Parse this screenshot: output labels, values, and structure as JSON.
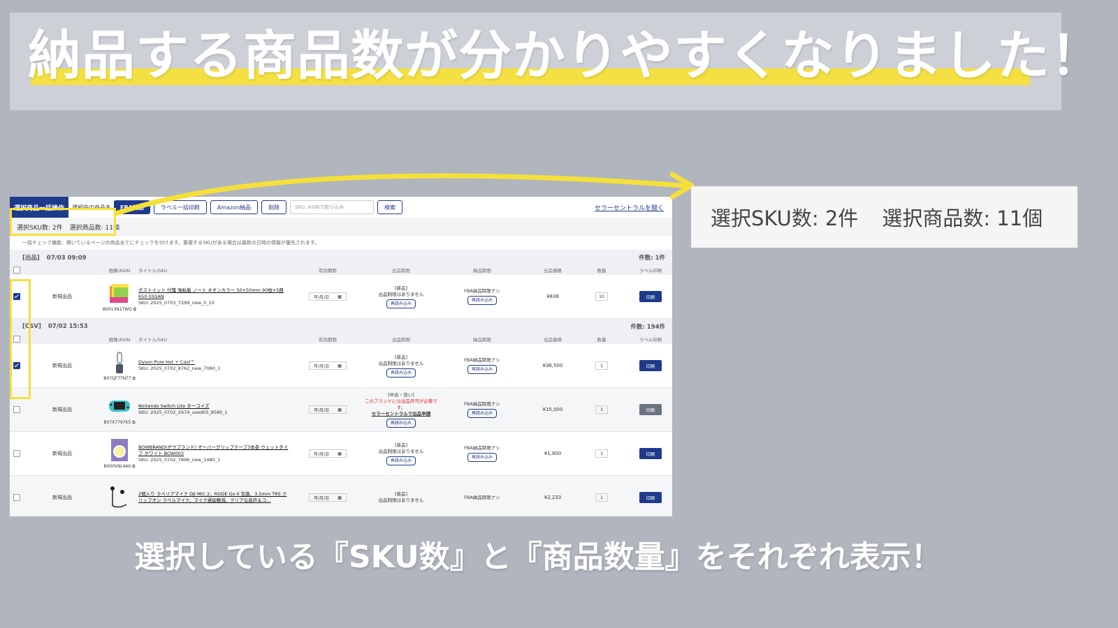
{
  "headline": "納品する商品数が分かりやすくなりました！",
  "caption": "選択している『SKU数』と『商品数量』をそれぞれ表示！",
  "zoom": {
    "sku": "選択SKU数: 2件",
    "items": "選択商品数: 11個"
  },
  "toolbar": {
    "tab": "選択商品一括操作",
    "label": "選択中の商品を",
    "fba": "FBA納品",
    "label_bulk": "ラベル一括印刷",
    "amazon": "Amazon納品",
    "delete": "削除",
    "search_placeholder": "SKU, ASINで絞り込み",
    "search_btn": "検索",
    "seller_link": "セラーセントラルを開く"
  },
  "counts": {
    "sku": "選択SKU数: 2件",
    "items": "選択商品数: 11個"
  },
  "note": "一括チェック機能：開いているページの商品全てにチェックを付けます。重複するSKUがある場合は最新の日時の情報が優先されます。",
  "columns": [
    "",
    "",
    "画像/ASIN",
    "タイトル/SKU",
    "有効期限",
    "出品制限",
    "納品制限",
    "出品価格",
    "数量",
    "ラベル印刷"
  ],
  "groups": [
    {
      "tag": "[出品]",
      "time": "07/03 09:09",
      "count": "件数: 1件",
      "rows": [
        {
          "checked": true,
          "status": "新規出品",
          "asin": "B0013N1TWG",
          "title": "ポストイット 付箋 強粘着 ノート ネオンカラー 50×50mm 90枚×5冊 650-5SSAN",
          "sku": "SKU: 2025_0703_7299_new_0_10",
          "date": "年/月/日",
          "restrict_tag": "[新品]",
          "restrict_text": "出品制限はありません",
          "restrict_alert": "",
          "restrict_link": "",
          "restrict_btn": "再読み込み",
          "fba_text": "FBA納品制限ナシ",
          "fba_btn": "再読み込み",
          "price": "¥838",
          "qty": "10",
          "print": "印刷",
          "print_gray": false,
          "thumb": "postit"
        }
      ]
    },
    {
      "tag": "[CSV]",
      "time": "07/02 15:53",
      "count": "件数: 194件",
      "rows": [
        {
          "checked": true,
          "status": "新規出品",
          "asin": "B07QF7TNT7",
          "title": "Dyson Pure Hot + Cool™",
          "sku": "SKU: 2025_0702_8762_new_7080_1",
          "date": "年/月/日",
          "restrict_tag": "[新品]",
          "restrict_text": "出品制限はありません",
          "restrict_alert": "",
          "restrict_link": "",
          "restrict_btn": "再読み込み",
          "fba_text": "FBA納品制限ナシ",
          "fba_btn": "再読み込み",
          "price": "¥36,500",
          "qty": "1",
          "print": "印刷",
          "print_gray": false,
          "thumb": "dyson"
        },
        {
          "checked": false,
          "status": "新規出品",
          "asin": "B07X7797K5",
          "title": "Nintendo Switch Lite ターコイズ",
          "sku": "SKU: 2025_0702_2674_used03_8580_1",
          "date": "年/月/日",
          "restrict_tag": "[中古・良い]",
          "restrict_text": "",
          "restrict_alert": "このブランドには出品許可が必要です。",
          "restrict_link": "セラーセントラルで出品申請",
          "restrict_btn": "再読み込み",
          "fba_text": "FBA納品制限ナシ",
          "fba_btn": "再読み込み",
          "price": "¥15,000",
          "qty": "3",
          "print": "印刷",
          "print_gray": true,
          "thumb": "switch"
        },
        {
          "checked": false,
          "status": "新規出品",
          "asin": "B000V8L4A6",
          "title": "BOWBRAND(ボウブランド) オーバーグリップテープ3本巻 ウェットタイプ ホワイト BOW003",
          "sku": "SKU: 2025_0702_7896_new_1480_1",
          "date": "年/月/日",
          "restrict_tag": "[新品]",
          "restrict_text": "出品制限はありません",
          "restrict_alert": "",
          "restrict_link": "",
          "restrict_btn": "再読み込み",
          "fba_text": "FBA納品制限ナシ",
          "fba_btn": "再読み込み",
          "price": "¥1,800",
          "qty": "1",
          "print": "印刷",
          "print_gray": false,
          "thumb": "grip"
        },
        {
          "checked": false,
          "status": "新規出品",
          "asin": "",
          "title": "2個入り ラベリアマイク DJI MIC 2、RODE Go II 互換、3.5mm TRS クリップオン ラベルマイク、マイク遅延軽減、クリアな音声＆コ…",
          "sku": "",
          "date": "年/月/日",
          "restrict_tag": "[新品]",
          "restrict_text": "出品制限はありません",
          "restrict_alert": "",
          "restrict_link": "",
          "restrict_btn": "",
          "fba_text": "FBA納品制限ナシ",
          "fba_btn": "",
          "price": "¥2,233",
          "qty": "1",
          "print": "印刷",
          "print_gray": false,
          "thumb": "mic"
        }
      ]
    }
  ]
}
